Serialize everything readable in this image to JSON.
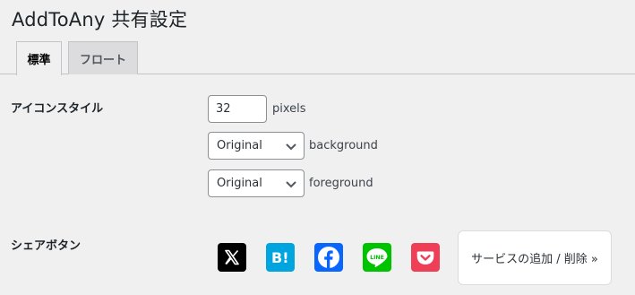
{
  "page": {
    "title": "AddToAny 共有設定"
  },
  "tabs": [
    {
      "label": "標準",
      "active": true
    },
    {
      "label": "フロート",
      "active": false
    }
  ],
  "icon_style": {
    "label": "アイコンスタイル",
    "size_value": "32",
    "size_suffix": "pixels",
    "background_value": "Original",
    "background_suffix": "background",
    "foreground_value": "Original",
    "foreground_suffix": "foreground"
  },
  "share_buttons": {
    "label": "シェアボタン",
    "services": [
      {
        "name": "x-icon",
        "color": "#000000"
      },
      {
        "name": "hatena-bookmark-icon",
        "color": "#00a4de"
      },
      {
        "name": "facebook-icon",
        "color": "#0866ff"
      },
      {
        "name": "line-icon",
        "color": "#00c300"
      },
      {
        "name": "pocket-icon",
        "color": "#ef3f56"
      }
    ],
    "add_button_label": "サービスの追加 / 削除 »"
  }
}
